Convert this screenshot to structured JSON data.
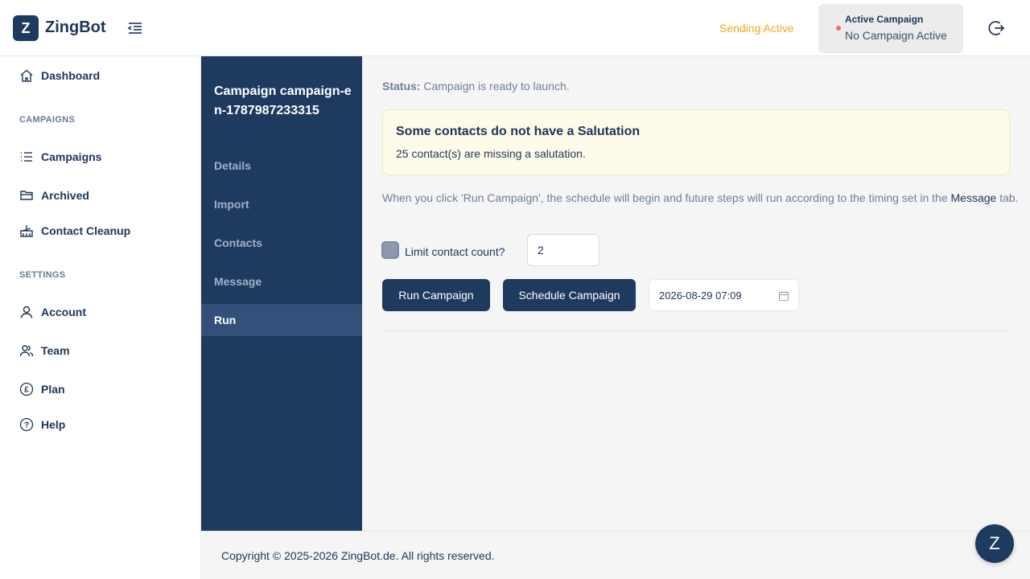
{
  "header": {
    "logo_letter": "Z",
    "app_name": "ZingBot",
    "sending_status": "Sending Active",
    "active_campaign_title": "Active Campaign",
    "active_campaign_value": "No Campaign Active"
  },
  "sidebar": {
    "dashboard": "Dashboard",
    "campaigns_section": "CAMPAIGNS",
    "campaigns": "Campaigns",
    "archived": "Archived",
    "contact_cleanup": "Contact Cleanup",
    "settings_section": "SETTINGS",
    "account": "Account",
    "team": "Team",
    "plan": "Plan",
    "help": "Help"
  },
  "campaign_nav": {
    "title": "Campaign campaign-en-1787987233315",
    "items": [
      "Details",
      "Import",
      "Contacts",
      "Message",
      "Run"
    ],
    "active": "Run"
  },
  "main": {
    "status_label": "Status:",
    "status_text": "Campaign is ready to launch.",
    "warning_title": "Some contacts do not have a Salutation",
    "warning_body": "25 contact(s) are missing a salutation.",
    "info_before": "When you click 'Run Campaign', the schedule will begin and future steps will run according to the timing set in the ",
    "info_link": "Message",
    "info_after": " tab.",
    "limit_label": "Limit contact count?",
    "limit_value": "2",
    "run_button": "Run Campaign",
    "schedule_button": "Schedule Campaign",
    "schedule_datetime": "2026-08-29 07:09"
  },
  "footer": {
    "copyright": "Copyright © 2025-2026 ZingBot.de. All rights reserved."
  },
  "chat": {
    "letter": "Z"
  },
  "colors": {
    "primary": "#1f3a5f",
    "sending_active": "#f0a81c",
    "warning_bg": "#fffbea",
    "status_dot": "#f26a6a"
  }
}
